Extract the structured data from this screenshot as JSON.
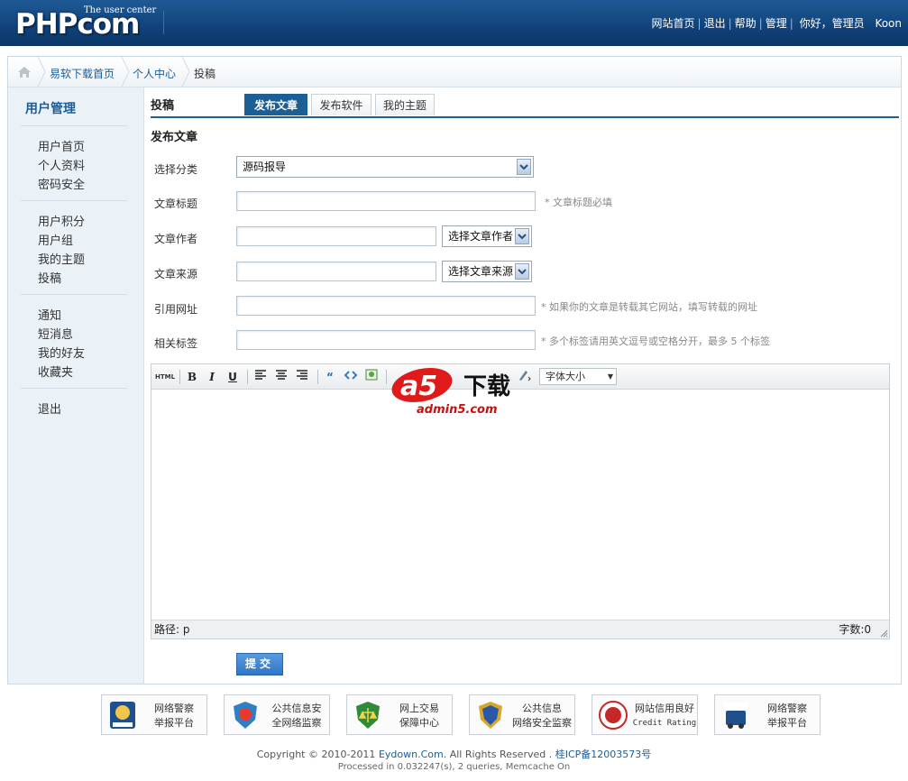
{
  "header": {
    "logo_text": "PHPcom",
    "logo_sub": "The user center",
    "nav": [
      "网站首页",
      "退出",
      "帮助",
      "管理"
    ],
    "greeting": "你好，管理员",
    "username": "Koon"
  },
  "breadcrumb": [
    "易软下载首页",
    "个人中心",
    "投稿"
  ],
  "sidebar": {
    "title": "用户管理",
    "groups": [
      [
        "用户首页",
        "个人资料",
        "密码安全"
      ],
      [
        "用户积分",
        "用户组",
        "我的主题",
        "投稿"
      ],
      [
        "通知",
        "短消息",
        "我的好友",
        "收藏夹"
      ],
      [
        "退出"
      ]
    ]
  },
  "content": {
    "section_title": "投稿",
    "tabs": [
      "发布文章",
      "发布软件",
      "我的主题"
    ],
    "active_tab": "发布文章",
    "form_title": "发布文章",
    "fields": {
      "category": {
        "label": "选择分类",
        "value": "源码报导"
      },
      "title": {
        "label": "文章标题",
        "hint": "* 文章标题必填"
      },
      "author": {
        "label": "文章作者",
        "select": "选择文章作者"
      },
      "source": {
        "label": "文章来源",
        "select": "选择文章来源"
      },
      "url": {
        "label": "引用网址",
        "hint": "* 如果你的文章是转载其它网站，填写转载的网址"
      },
      "tags": {
        "label": "相关标签",
        "hint": "* 多个标签请用英文逗号或空格分开，最多 5 个标签"
      }
    },
    "editor": {
      "toolbar_html": "HTML",
      "font_size": "字体大小",
      "path_label": "路径: p",
      "word_count": "字数:0"
    },
    "submit_label": "提交"
  },
  "footer": {
    "badges": [
      {
        "line1": "网络警察",
        "line2": "举报平台"
      },
      {
        "line1": "公共信息安",
        "line2": "全网络监察"
      },
      {
        "line1": "网上交易",
        "line2": "保障中心"
      },
      {
        "line1": "公共信息",
        "line2": "网络安全监察"
      },
      {
        "line1": "网站信用良好",
        "line2": "Credit Rating"
      },
      {
        "line1": "网络警察",
        "line2": "举报平台"
      }
    ],
    "copyright_prefix": "Copyright © 2010-2011 ",
    "copyright_site": "Eydown.Com",
    "copyright_mid": ". All Rights Reserved . ",
    "icp": "桂ICP备12003573号",
    "processed": "Processed in 0.032247(s), 2 queries, Memcache On"
  },
  "watermark": {
    "brand": "a5",
    "label": "下载",
    "domain": "admin5.com"
  },
  "colors": {
    "header": "#0e3f75",
    "accent": "#1c5f95",
    "sidebar_bg": "#eaf2f8"
  }
}
